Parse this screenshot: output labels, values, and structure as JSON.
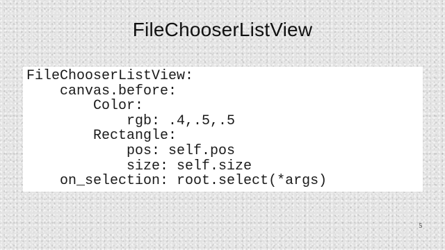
{
  "slide": {
    "title": "FileChooserListView",
    "page_number": "5"
  },
  "code": {
    "lines": [
      {
        "indent": "",
        "text": "FileChooserListView:"
      },
      {
        "indent": "    ",
        "text": "canvas.before:"
      },
      {
        "indent": "        ",
        "text": "Color:"
      },
      {
        "indent": "            ",
        "text": "rgb: .4,.5,.5"
      },
      {
        "indent": "        ",
        "text": "Rectangle:"
      },
      {
        "indent": "            ",
        "text": "pos: self.pos"
      },
      {
        "indent": "            ",
        "text": "size: self.size"
      },
      {
        "indent": "    ",
        "text": "on_selection: root.select(*args)"
      }
    ]
  }
}
